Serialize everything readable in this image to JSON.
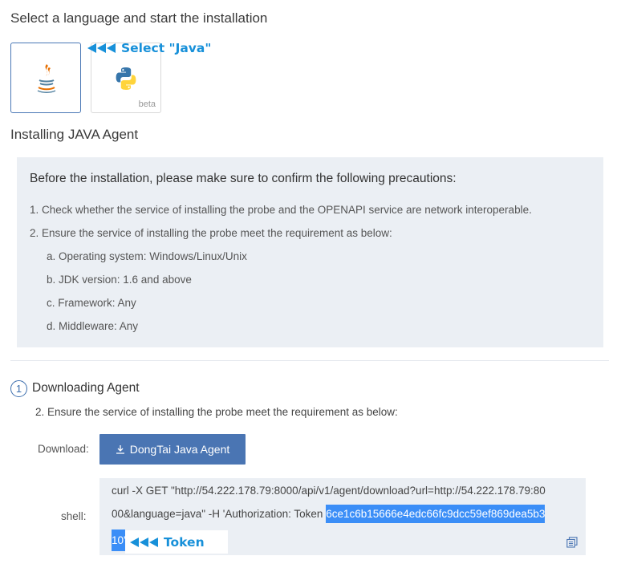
{
  "page": {
    "title": "Select a language and start the installation",
    "subtitle": "Installing JAVA Agent"
  },
  "languages": [
    {
      "name": "Java",
      "icon": "java-icon",
      "selected": true
    },
    {
      "name": "Python",
      "icon": "python-icon",
      "badge": "beta",
      "selected": false
    }
  ],
  "annotations": {
    "select_java": "Select \"Java\"",
    "token": "Token",
    "color": "#1790d9"
  },
  "precautions": {
    "title": "Before the installation, please make sure to confirm the following precautions:",
    "items": [
      "1. Check whether the service of installing the probe and the OPENAPI service are network interoperable.",
      "2. Ensure the service of installing the probe meet the requirement as below:",
      "a. Operating system: Windows/Linux/Unix",
      "b. JDK version: 1.6 and above",
      "c. Framework: Any",
      "d. Middleware: Any"
    ]
  },
  "step1": {
    "number": "1",
    "title": "Downloading Agent",
    "description": "2. Ensure the service of installing the probe meet the requirement as below:"
  },
  "download": {
    "label": "Download:",
    "button_label": "DongTai Java Agent",
    "icon": "download-icon",
    "button_color": "#4a75b3"
  },
  "shell": {
    "label": "shell:",
    "line1": "curl -X GET \"http://54.222.178.79:8000/api/v1/agent/download?url=http://54.222.178.79:80",
    "line2_prefix": "00&language=java\" -H 'Authorization: Token ",
    "token_part1": "6ce1c6b15666e4edc66fc9dcc59ef869dea5b3",
    "token_part2": "10'",
    "copy_icon": "copy-icon",
    "highlight_color": "#3b8ef7"
  }
}
